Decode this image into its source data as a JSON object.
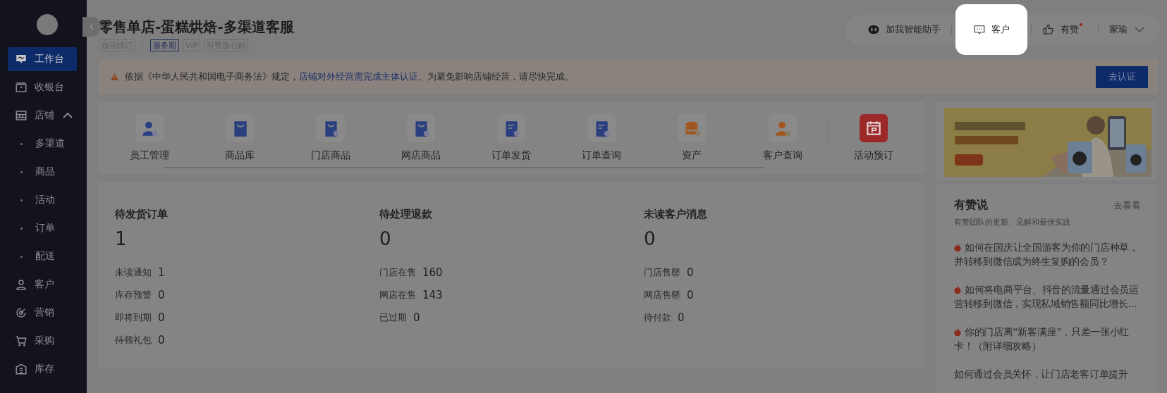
{
  "sidebar": {
    "items": [
      {
        "label": "工作台",
        "selected": true
      },
      {
        "label": "收银台",
        "selected": false
      },
      {
        "label": "店铺",
        "selected": false,
        "expanded": true,
        "children": [
          {
            "label": "多渠道",
            "selected": false
          },
          {
            "label": "商品",
            "selected": false
          },
          {
            "label": "活动",
            "selected": false
          },
          {
            "label": "订单",
            "selected": false
          },
          {
            "label": "配送",
            "selected": false
          }
        ]
      },
      {
        "label": "客户",
        "selected": false
      },
      {
        "label": "营销",
        "selected": false
      },
      {
        "label": "采购",
        "selected": false
      },
      {
        "label": "库存",
        "selected": false
      }
    ]
  },
  "header": {
    "title": "零售单店-蛋糕烘焙-多渠道客服",
    "tags": [
      {
        "label": "自动续订",
        "active": false
      },
      {
        "label": "服务期",
        "active": true
      },
      {
        "label": "VIP",
        "active": false
      },
      {
        "label": "有赞放心购",
        "active": false
      }
    ]
  },
  "toolbar": {
    "assistant": "加我智能助手",
    "customer": {
      "label": "客户",
      "highlighted": true
    },
    "like": {
      "label": "有赞",
      "unread": true
    },
    "user": "家瑜"
  },
  "alert": {
    "text_before": "依据《中华人民共和国电子商务法》规定，",
    "link": "店铺对外经营需完成主体认证",
    "text_after": "。为避免影响店铺经营，请尽快完成。",
    "button": "去认证"
  },
  "quick_links": [
    {
      "label": "员工管理"
    },
    {
      "label": "商品库"
    },
    {
      "label": "门店商品"
    },
    {
      "label": "网店商品"
    },
    {
      "label": "订单发货"
    },
    {
      "label": "订单查询"
    },
    {
      "label": "资产"
    },
    {
      "label": "客户查询"
    },
    {
      "label": "活动预订"
    }
  ],
  "stats": [
    {
      "title": "待发货订单",
      "value": "1",
      "rows": [
        {
          "label": "未读通知",
          "value": "1"
        },
        {
          "label": "库存预警",
          "value": "0"
        },
        {
          "label": "即将到期",
          "value": "0"
        },
        {
          "label": "待领礼包",
          "value": "0"
        }
      ]
    },
    {
      "title": "待处理退款",
      "value": "0",
      "rows": [
        {
          "label": "门店在售",
          "value": "160"
        },
        {
          "label": "网店在售",
          "value": "143"
        },
        {
          "label": "已过期",
          "value": "0"
        }
      ]
    },
    {
      "title": "未读客户消息",
      "value": "0",
      "rows": [
        {
          "label": "门店售罄",
          "value": "0"
        },
        {
          "label": "网店售罄",
          "value": "0"
        },
        {
          "label": "待付款",
          "value": "0"
        }
      ]
    }
  ],
  "news": {
    "title": "有赞说",
    "more": "去看看",
    "subtitle": "有赞团队的更新、见解和最佳实践",
    "items": [
      {
        "text": "如何在国庆让全国游客为你的门店种草，并转移到微信成为终生复购的会员？",
        "hot": true
      },
      {
        "text": "如何将电商平台、抖音的流量通过会员运营转移到微信，实现私域销售额同比增长...",
        "hot": true
      },
      {
        "text": "你的门店离“新客满座”，只差一张小红卡！（附详细攻略）",
        "hot": true
      },
      {
        "text": "如何通过会员关怀，让门店老客订单提升",
        "hot": false
      }
    ]
  }
}
